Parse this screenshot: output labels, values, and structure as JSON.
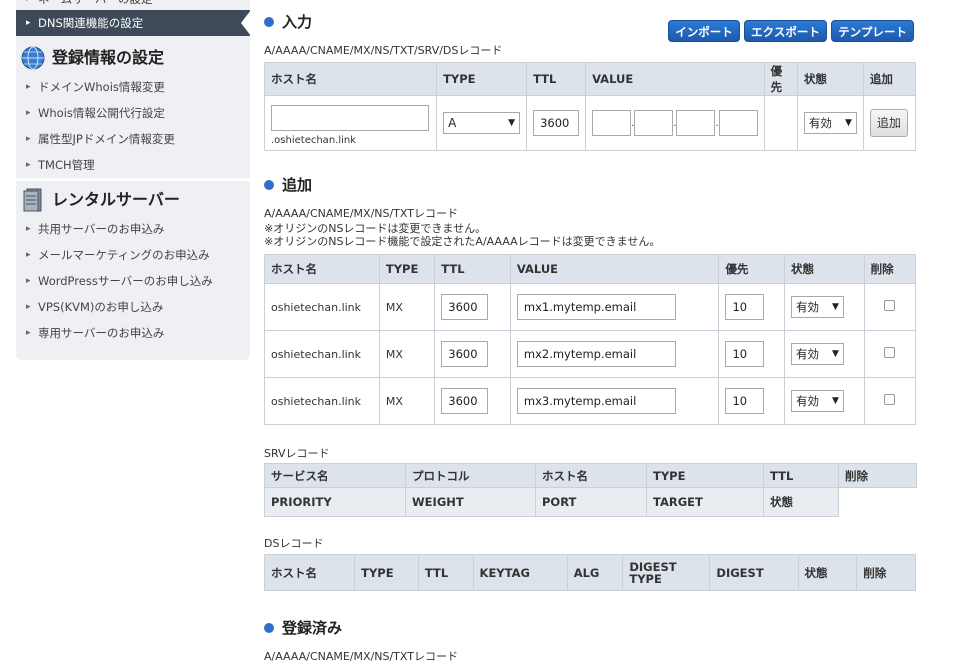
{
  "sidebar": {
    "cut_item": "ネームサーバーの設定",
    "active_item": "DNS関連機能の設定",
    "section1_title": "登録情報の設定",
    "section1_items": [
      "ドメインWhois情報変更",
      "Whois情報公開代行設定",
      "属性型JPドメイン情報変更",
      "TMCH管理"
    ],
    "section2_title": "レンタルサーバー",
    "section2_items": [
      "共用サーバーのお申込み",
      "メールマーケティングのお申込み",
      "WordPressサーバーのお申し込み",
      "VPS(KVM)のお申し込み",
      "専用サーバーのお申込み"
    ]
  },
  "input_section": {
    "title": "入力",
    "buttons": {
      "import": "インポート",
      "export": "エクスポート",
      "template": "テンプレート"
    },
    "record_types": "A/AAAA/CNAME/MX/NS/TXT/SRV/DSレコード",
    "headers": [
      "ホスト名",
      "TYPE",
      "TTL",
      "VALUE",
      "優先",
      "状態",
      "追加"
    ],
    "host_value": "",
    "domain_suffix": ".oshietechan.link",
    "type_value": "A",
    "ttl_value": "3600",
    "status_value": "有効",
    "add_button": "追加"
  },
  "add_section": {
    "title": "追加",
    "record_types": "A/AAAA/CNAME/MX/NS/TXTレコード",
    "note1": "※オリジンのNSレコードは変更できません。",
    "note2": "※オリジンのNSレコード機能で設定されたA/AAAAレコードは変更できません。",
    "headers": [
      "ホスト名",
      "TYPE",
      "TTL",
      "VALUE",
      "優先",
      "状態",
      "削除"
    ],
    "rows": [
      {
        "host": "oshietechan.link",
        "type": "MX",
        "ttl": "3600",
        "value": "mx1.mytemp.email",
        "priority": "10",
        "status": "有効"
      },
      {
        "host": "oshietechan.link",
        "type": "MX",
        "ttl": "3600",
        "value": "mx2.mytemp.email",
        "priority": "10",
        "status": "有効"
      },
      {
        "host": "oshietechan.link",
        "type": "MX",
        "ttl": "3600",
        "value": "mx3.mytemp.email",
        "priority": "10",
        "status": "有効"
      }
    ]
  },
  "srv_section": {
    "label": "SRVレコード",
    "headers_row1": [
      "サービス名",
      "プロトコル",
      "ホスト名",
      "TYPE",
      "TTL",
      "削除"
    ],
    "headers_row2": [
      "PRIORITY",
      "WEIGHT",
      "PORT",
      "TARGET",
      "状態"
    ]
  },
  "ds_section": {
    "label": "DSレコード",
    "headers": [
      "ホスト名",
      "TYPE",
      "TTL",
      "KEYTAG",
      "ALG",
      "DIGEST TYPE",
      "DIGEST",
      "状態",
      "削除"
    ]
  },
  "registered_section": {
    "title": "登録済み",
    "record_types": "A/AAAA/CNAME/MX/NS/TXTレコード"
  },
  "colors": {
    "accent": "#2f6fc7",
    "sidebar_bg": "#eef0f3",
    "sidebar_active": "#3e4a59",
    "table_header": "#dde3ea"
  }
}
